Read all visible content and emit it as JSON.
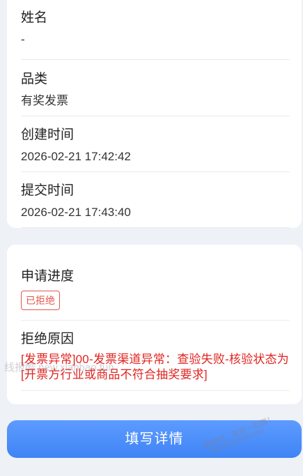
{
  "info": {
    "name_label": "姓名",
    "name_value": "-",
    "category_label": "品类",
    "category_value": "有奖发票",
    "created_label": "创建时间",
    "created_value": "2026-02-21 17:42:42",
    "submitted_label": "提交时间",
    "submitted_value": "2026-02-21 17:43:40"
  },
  "progress": {
    "label": "申请进度",
    "status": "已拒绝",
    "status_color": "#e2574c"
  },
  "rejection": {
    "label": "拒绝原因",
    "reason": "[发票异常]00-发票渠道异常：查验失败-核验状态为[开票方行业或商品不符合抽奖要求]",
    "reason_color": "#e02420"
  },
  "action": {
    "button_label": "填写详情",
    "button_color": "#4a8cf8"
  },
  "watermarks": {
    "left": "线报酷 new.xianbao.fun",
    "right_line1": "赚客吧，有奖一起赚！",
    "right_line2": "www.zuanke8.com"
  }
}
